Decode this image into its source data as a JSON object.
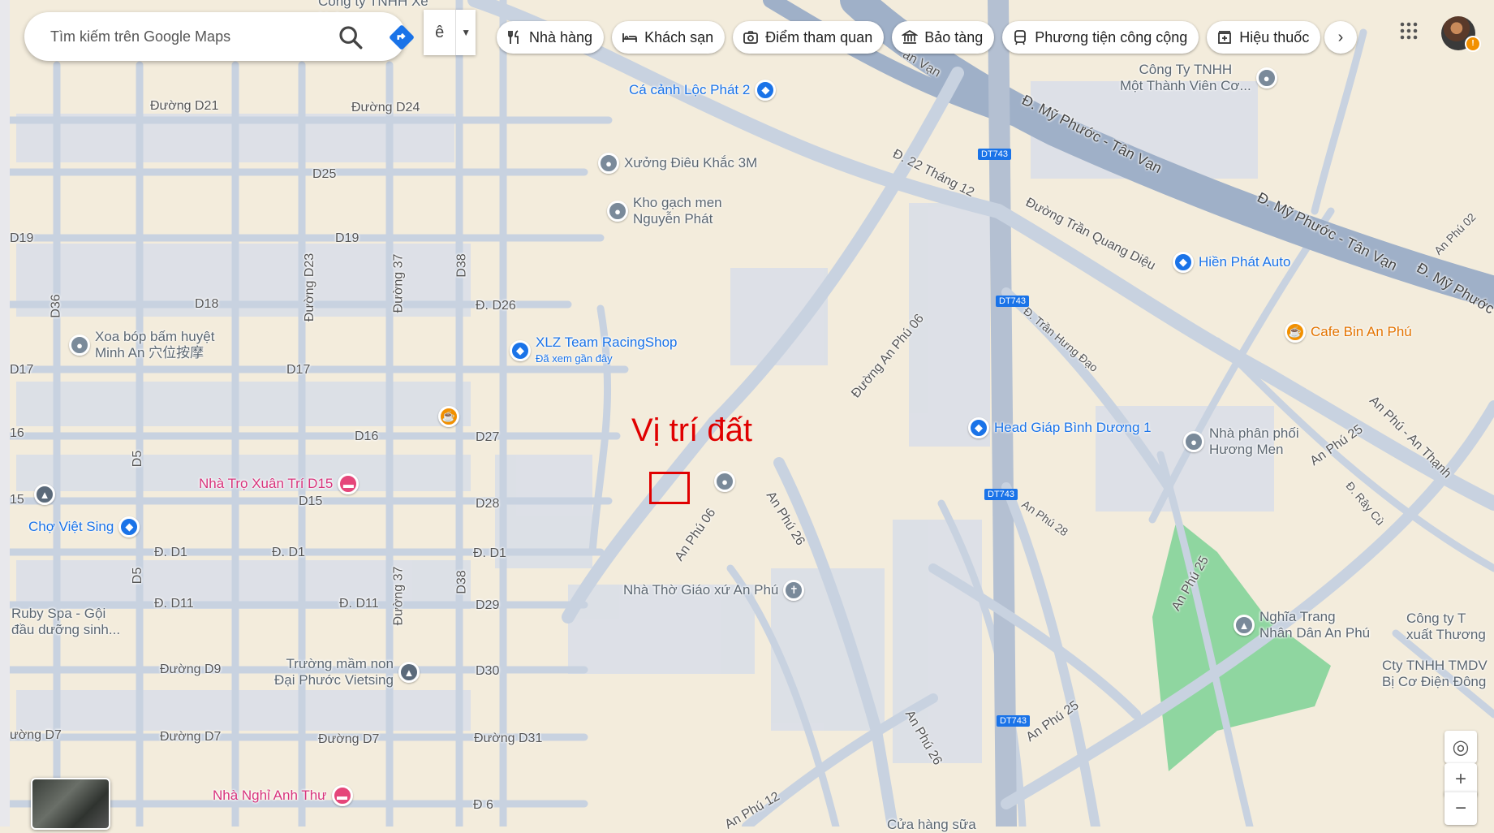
{
  "search": {
    "placeholder": "Tìm kiếm trên Google Maps"
  },
  "ime": {
    "char": "ê"
  },
  "chips": [
    {
      "label": "Nhà hàng",
      "icon": "restaurant-icon"
    },
    {
      "label": "Khách sạn",
      "icon": "hotel-icon"
    },
    {
      "label": "Điểm tham quan",
      "icon": "camera-icon"
    },
    {
      "label": "Bảo tàng",
      "icon": "museum-icon"
    },
    {
      "label": "Phương tiện công cộng",
      "icon": "transit-icon"
    },
    {
      "label": "Hiệu thuốc",
      "icon": "pharmacy-icon"
    }
  ],
  "annotation": "Vị trí đất",
  "roads": {
    "d21": "Đường D21",
    "d24": "Đường D24",
    "d25": "D25",
    "d19": "D19",
    "d19l": "D19",
    "d18": "D18",
    "d17": "D17",
    "d17l": "D17",
    "d16": "D16",
    "d16l": "16",
    "d15": "D15",
    "d15l": "15",
    "d1a": "Đ. D1",
    "d1b": "Đ. D1",
    "d1c": "Đ. D1",
    "d11a": "Đ. D11",
    "d11b": "Đ. D11",
    "d9": "Đường D9",
    "d7a": "Đường D7",
    "d7b": "Đường D7",
    "d7l": "ường D7",
    "d26": "Đ. D26",
    "d27": "D27",
    "d28": "D28",
    "d29": "D29",
    "d30": "D30",
    "d31": "Đường D31",
    "d6": "Đ 6",
    "d23": "Đường D23",
    "d37a": "Đường 37",
    "d37b": "Đường 37",
    "d38a": "D38",
    "d38b": "D38",
    "d36": "D36",
    "d5a": "D5",
    "d5b": "D5",
    "my_phuoc1": "Đ. Mỹ Phước - Tân Vạn",
    "my_phuoc2": "Đ. Mỹ Phước - Tân Vạn",
    "my_phuoc3": "Đ. Mỹ Phước",
    "tan_van": "ân Vạn",
    "t22": "Đ. 22 Tháng 12",
    "tqd": "Đường Trần Quang Diệu",
    "thd": "Đ. Trần Hưng Đạo",
    "ap06a": "Đường An Phú 06",
    "ap06b": "An Phú 06",
    "ap26a": "An Phú 26",
    "ap26b": "An Phú 26",
    "ap28": "An Phú 28",
    "ap25a": "An Phú 25",
    "ap25b": "An Phú 25",
    "ap25c": "An Phú 25",
    "ap02": "An Phú 02",
    "ap12": "An Phú 12",
    "apat": "An Phú - An Thạnh",
    "raycu": "Đ. Rây Cù",
    "dt743a": "DT743",
    "dt743b": "DT743",
    "dt743c": "DT743",
    "dt743d": "DT743"
  },
  "places": [
    {
      "name": "Cá cảnh Lộc Phát 2",
      "type": "blue"
    },
    {
      "name": "Xưởng Điêu Khắc 3M",
      "type": "gray"
    },
    {
      "name": "Kho gạch men\nNguyễn Phát",
      "type": "gray"
    },
    {
      "name": "XLZ Team RacingShop",
      "type": "blue",
      "sub": "Đã xem gần đây"
    },
    {
      "name": "Xoa bóp bấm huyệt\nMinh An 穴位按摩",
      "type": "gray"
    },
    {
      "name": "Nhà Trọ Xuân Trí D15",
      "type": "pink"
    },
    {
      "name": "Chợ Việt Sing",
      "type": "blue"
    },
    {
      "name": "Ruby Spa - Gội\nđầu dưỡng sinh...",
      "type": "gray"
    },
    {
      "name": "Trường mầm non\nĐại Phước Vietsing",
      "type": "gray"
    },
    {
      "name": "Nhà Nghỉ Anh Thư",
      "type": "pink"
    },
    {
      "name": "Nhà Thờ Giáo xứ An Phú",
      "type": "gray"
    },
    {
      "name": "Head Giáp Bình Dương 1",
      "type": "blue"
    },
    {
      "name": "Nhà phân phối\nHương Men",
      "type": "gray"
    },
    {
      "name": "Hiền Phát Auto",
      "type": "blue"
    },
    {
      "name": "Cafe Bin An Phú",
      "type": "orange"
    },
    {
      "name": "Công Ty TNHH\nMột Thành Viên Cơ...",
      "type": "gray"
    },
    {
      "name": "Nghĩa Trang\nNhân Dân An Phú",
      "type": "gray"
    },
    {
      "name": "Công ty T\nxuất Thương",
      "type": "gray"
    },
    {
      "name": "Cty TNHH TMDV\nBị Cơ Điện Đông",
      "type": "gray"
    },
    {
      "name": "Công ty TNHH Xe\nNgh",
      "type": "gray"
    },
    {
      "name": "Cửa hàng sữa",
      "type": "gray"
    }
  ],
  "colors": {
    "land": "#f3ecdc",
    "road": "#c8d2e0",
    "major": "#b4c0d2",
    "park": "#8fd6a0",
    "building": "#d7dce6",
    "annotation": "#e00000"
  }
}
